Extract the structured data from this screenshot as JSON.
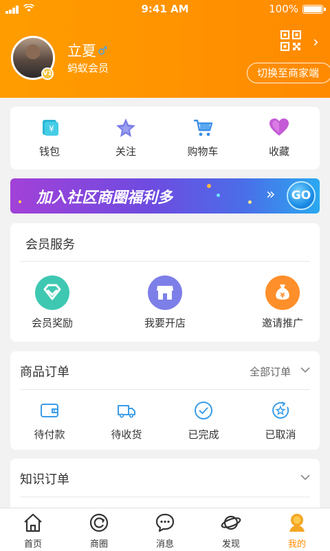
{
  "status_bar": {
    "time": "9:41 AM",
    "battery": "100%"
  },
  "profile": {
    "name": "立夏",
    "gender_symbol": "♂",
    "member_level": "蚂蚁会员",
    "vip_badge": "V1",
    "switch_button": "切换至商家端"
  },
  "quick_actions": [
    {
      "label": "钱包",
      "icon": "wallet-icon"
    },
    {
      "label": "关注",
      "icon": "star-icon"
    },
    {
      "label": "购物车",
      "icon": "cart-icon"
    },
    {
      "label": "收藏",
      "icon": "heart-icon"
    }
  ],
  "banner": {
    "text": "加入社区商圈福利多",
    "arrows": "»",
    "go": "GO"
  },
  "member_services": {
    "title": "会员服务",
    "items": [
      {
        "label": "会员奖励",
        "icon": "diamond-icon",
        "color": "#3ec8b2"
      },
      {
        "label": "我要开店",
        "icon": "store-icon",
        "color": "#7d7fe8"
      },
      {
        "label": "邀请推广",
        "icon": "money-bag-icon",
        "color": "#ff8f2a"
      }
    ]
  },
  "goods_orders": {
    "title": "商品订单",
    "all_label": "全部订单",
    "items": [
      {
        "label": "待付款",
        "icon": "wallet-outline-icon"
      },
      {
        "label": "待收货",
        "icon": "truck-icon"
      },
      {
        "label": "已完成",
        "icon": "check-circle-icon"
      },
      {
        "label": "已取消",
        "icon": "cancel-circle-icon"
      }
    ]
  },
  "knowledge_orders": {
    "title": "知识订单"
  },
  "tabbar": [
    {
      "label": "首页",
      "icon": "home-icon"
    },
    {
      "label": "商圈",
      "icon": "circle-refresh-icon"
    },
    {
      "label": "消息",
      "icon": "chat-icon"
    },
    {
      "label": "发现",
      "icon": "planet-icon"
    },
    {
      "label": "我的",
      "icon": "me-icon",
      "active": true
    }
  ],
  "colors": {
    "brand_orange": "#ff8a00",
    "accent_blue": "#3a9ce8"
  }
}
